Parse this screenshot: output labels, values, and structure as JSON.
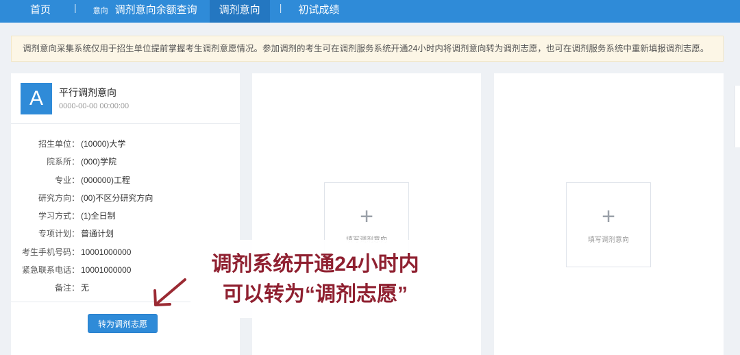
{
  "nav": {
    "home": "首页",
    "small_tab": "意向",
    "balance_query": "调剂意向余额查询",
    "intent": "调剂意向",
    "first_score": "初试成绩",
    "separator": "|"
  },
  "notice": "调剂意向采集系统仅用于招生单位提前掌握考生调剂意愿情况。参加调剂的考生可在调剂服务系统开通24小时内将调剂意向转为调剂志愿，也可在调剂服务系统中重新填报调剂志愿。",
  "card": {
    "avatar_letter": "A",
    "title": "平行调剂意向",
    "time": "0000-00-00 00:00:00",
    "fields": [
      {
        "key": "招生单位：",
        "value": "(10000)大学"
      },
      {
        "key": "院系所：",
        "value": "(000)学院"
      },
      {
        "key": "专业：",
        "value": "(000000)工程"
      },
      {
        "key": "研究方向：",
        "value": "(00)不区分研究方向"
      },
      {
        "key": "学习方式：",
        "value": "(1)全日制"
      },
      {
        "key": "专项计划：",
        "value": "普通计划"
      },
      {
        "key": "考生手机号码：",
        "value": "10001000000"
      },
      {
        "key": "紧急联系电话：",
        "value": "10001000000"
      },
      {
        "key": "备注：",
        "value": "无"
      }
    ],
    "convert_button": "转为调剂志愿"
  },
  "add_slot": {
    "plus": "+",
    "label": "填写调剂意向"
  },
  "caption": {
    "line1": "调剂系统开通24小时内",
    "line2": "可以转为“调剂志愿”"
  },
  "colors": {
    "primary": "#2f8bd8",
    "caption_text": "#8f2030",
    "arrow": "#9b2a33"
  }
}
